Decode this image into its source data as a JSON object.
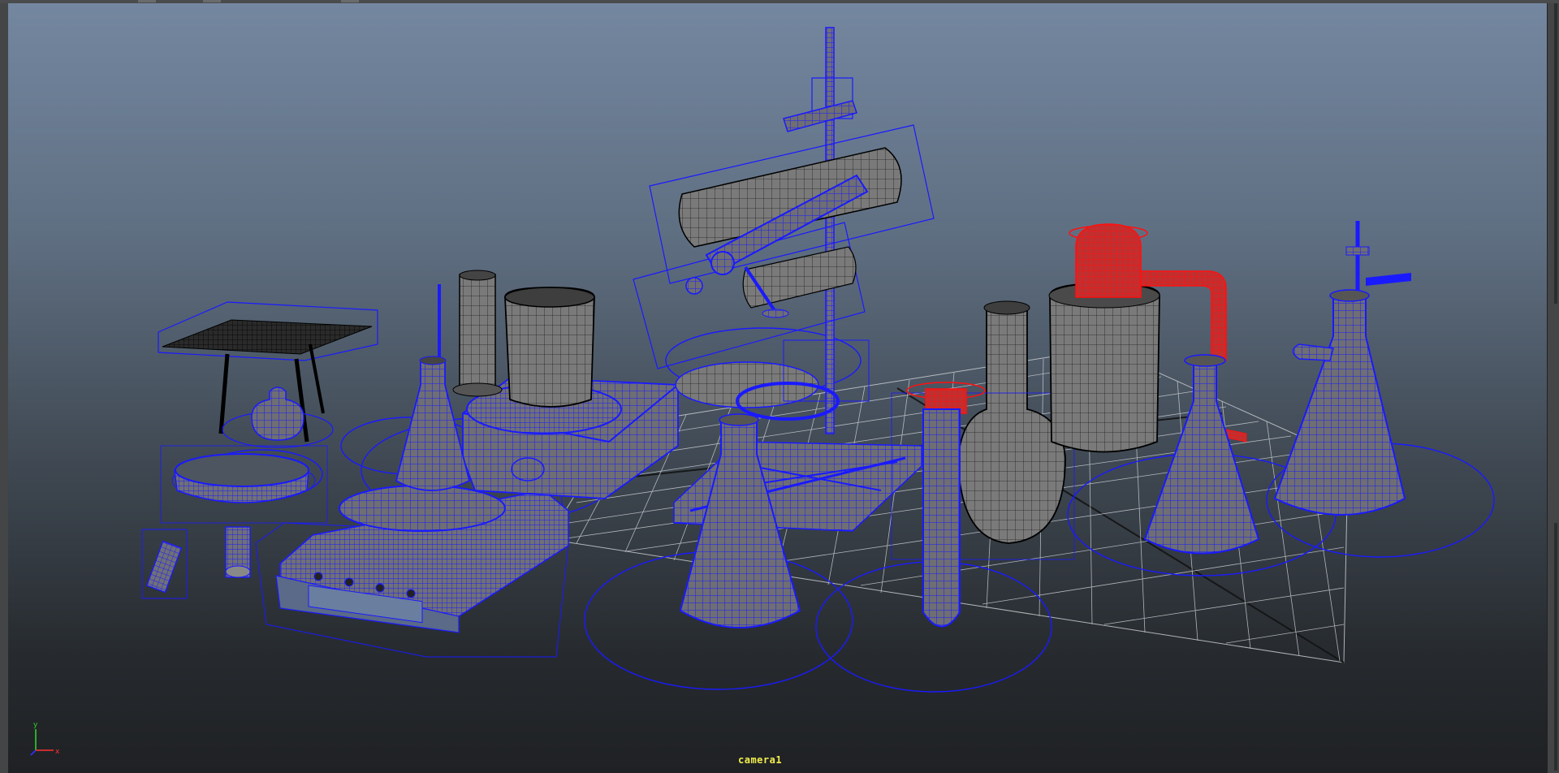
{
  "app": {
    "viewport": {
      "camera_name": "camera1",
      "axis_labels": {
        "x": "x",
        "y": "y"
      },
      "colors": {
        "selected_wire": "#1a1aff",
        "highlight_wire": "#ff1010",
        "unselected_shaded": "#6b6b6b",
        "grid": "#c8ccd0",
        "camera_label": "#f2ee4e"
      },
      "objects": [
        {
          "name": "tripod-stand",
          "state": "selected"
        },
        {
          "name": "alcohol-lamp",
          "state": "selected"
        },
        {
          "name": "evaporating-dish",
          "state": "selected"
        },
        {
          "name": "small-vials",
          "state": "selected"
        },
        {
          "name": "graduated-cylinder",
          "state": "unselected"
        },
        {
          "name": "beaker",
          "state": "unselected"
        },
        {
          "name": "hot-plate-stirrer",
          "state": "selected"
        },
        {
          "name": "electronic-balance",
          "state": "selected"
        },
        {
          "name": "small-erlenmeyer-flask",
          "state": "selected"
        },
        {
          "name": "retort-stand",
          "state": "selected"
        },
        {
          "name": "condenser",
          "state": "selected"
        },
        {
          "name": "support-jack",
          "state": "selected"
        },
        {
          "name": "large-erlenmeyer-flask",
          "state": "selected"
        },
        {
          "name": "test-tube",
          "state": "selected"
        },
        {
          "name": "round-bottom-flask",
          "state": "unselected"
        },
        {
          "name": "gas-cylinder",
          "state": "unselected"
        },
        {
          "name": "delivery-tube",
          "state": "highlighted"
        },
        {
          "name": "right-erlenmeyer-flask",
          "state": "selected"
        },
        {
          "name": "filter-flask",
          "state": "selected"
        }
      ]
    }
  }
}
